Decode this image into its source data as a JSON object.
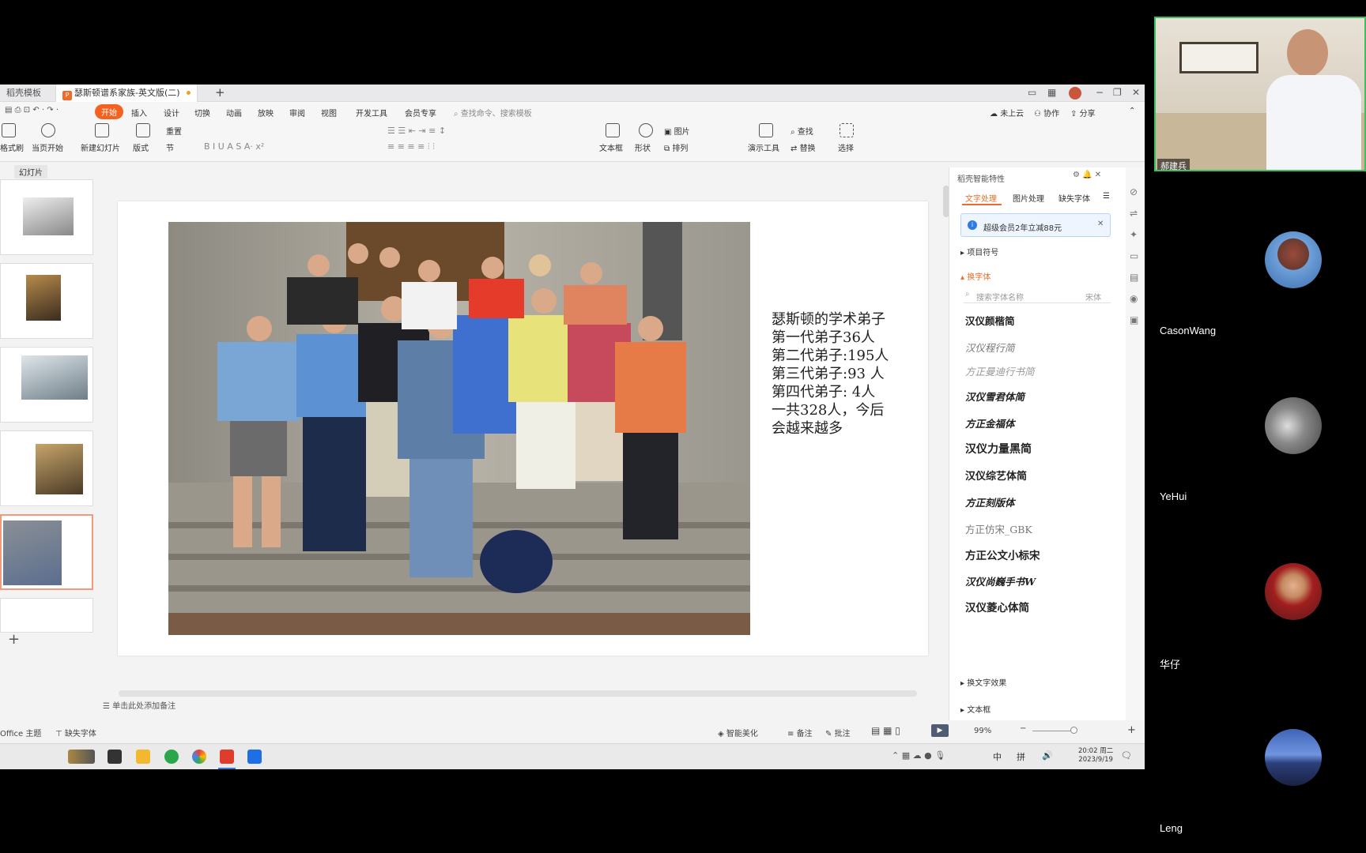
{
  "app": {
    "prev_tab": "稻壳模板",
    "doc_tab": "瑟斯顿谱系家族-英文版(二)",
    "new_tab_icon": "+"
  },
  "menu": {
    "items": [
      "开始",
      "插入",
      "设计",
      "切换",
      "动画",
      "放映",
      "审阅",
      "视图",
      "开发工具",
      "会员专享"
    ],
    "search": "查找命令、搜索模板",
    "right": [
      "未上云",
      "协作",
      "分享"
    ]
  },
  "toolbar": {
    "left_partial": "格式刷",
    "buttons": [
      "当页开始",
      "新建幻灯片",
      "版式",
      "节",
      "重置"
    ],
    "mid": [
      "文本框",
      "形状",
      "图片",
      "排列",
      "演示工具",
      "查找",
      "替换",
      "选择"
    ]
  },
  "outline": {
    "tab": "幻灯片"
  },
  "slide": {
    "text_lines": [
      "瑟斯顿的学术弟子",
      "第一代弟子36人",
      "第二代弟子:195人",
      "第三代弟子:93 人",
      "第四代弟子:  4人",
      "一共328人，今后",
      "会越来越多"
    ]
  },
  "notes": {
    "placeholder": "单击此处添加备注"
  },
  "status": {
    "theme": "Office 主题",
    "missing_font": "缺失字体",
    "beautify": "智能美化",
    "notes": "备注",
    "comment": "批注",
    "zoom": "99%"
  },
  "sidepanel": {
    "title": "稻壳智能特性",
    "tabs": [
      "文字处理",
      "图片处理",
      "缺失字体"
    ],
    "promo": "超级会员2年立减88元",
    "section_bullets": "项目符号",
    "section_font": "换字体",
    "search_placeholder": "搜索字体名称",
    "current_font": "宋体",
    "fonts": [
      "汉仪颜楷简",
      "汉仪程行简",
      "方正曼迪行书简",
      "汉仪雪君体简",
      "方正金福体",
      "汉仪力量黑简",
      "汉仪综艺体简",
      "方正刻版体",
      "方正仿宋_GBK",
      "方正公文小标宋",
      "汉仪尚巍手书W",
      "汉仪菱心体简"
    ],
    "section_effect": "换文字效果",
    "section_textbox": "文本框"
  },
  "taskbar": {
    "clock_time": "20:02 周二",
    "clock_date": "2023/9/19",
    "ime1": "中",
    "ime2": "拼"
  },
  "participants": [
    {
      "name": "郝建兵"
    },
    {
      "name": "CasonWang"
    },
    {
      "name": "YeHui"
    },
    {
      "name": "华仔"
    },
    {
      "name": "Leng"
    }
  ]
}
